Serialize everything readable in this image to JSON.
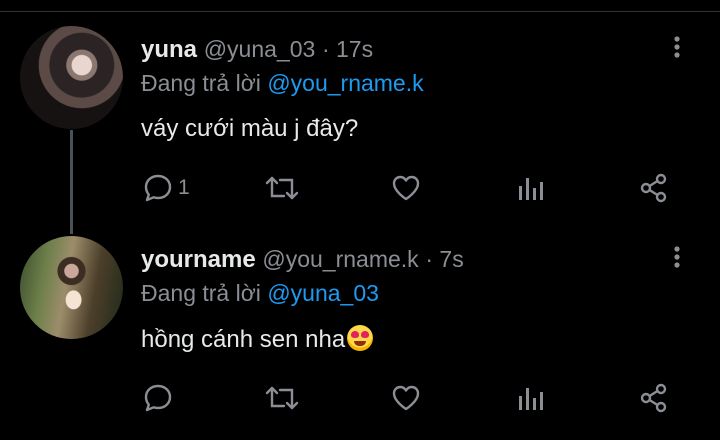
{
  "tweets": [
    {
      "display_name": "yuna",
      "handle": "@yuna_03",
      "time": "· 17s",
      "reply_prefix": "Đang trả lời",
      "reply_to": "@you_rname.k",
      "text": "váy cưới màu j đây?",
      "reply_count": "1",
      "avatar_icon": "profile-photo"
    },
    {
      "display_name": "yourname",
      "handle": "@you_rname.k",
      "time": "· 7s",
      "reply_prefix": "Đang trả lời",
      "reply_to": "@yuna_03",
      "text": "hồng cánh sen nha",
      "emoji": "heart-eyes-emoji",
      "reply_count": "",
      "avatar_icon": "profile-photo"
    }
  ],
  "icons": {
    "reply": "comment-icon",
    "retweet": "retweet-icon",
    "like": "heart-icon",
    "analytics": "bar-chart-icon",
    "share": "share-icon",
    "more": "more-vertical-icon"
  },
  "colors": {
    "background": "#000000",
    "text": "#e7e9ea",
    "muted": "#8b8f94",
    "link": "#1d9bf0"
  }
}
